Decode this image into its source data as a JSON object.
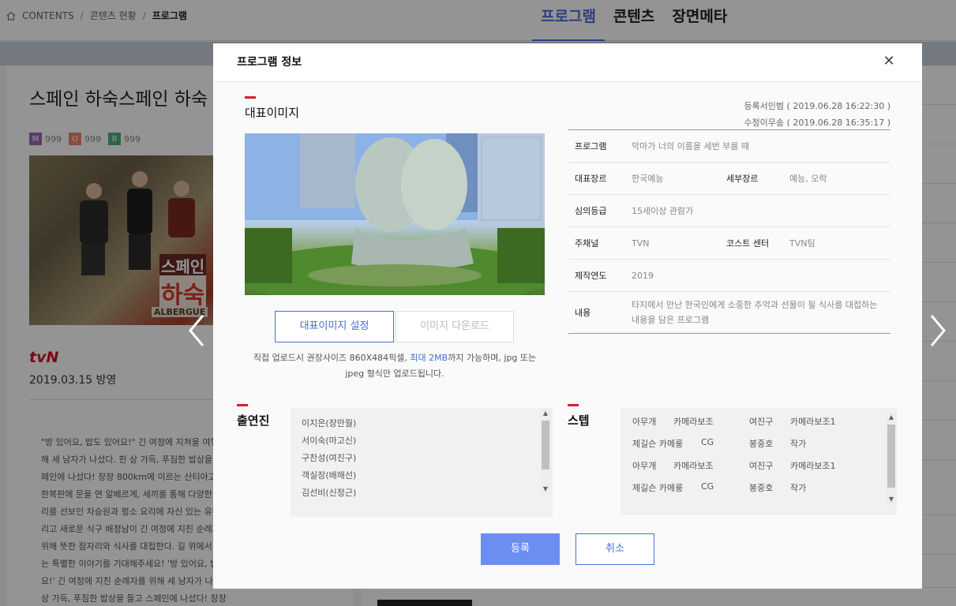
{
  "breadcrumb": {
    "items": [
      "CONTENTS",
      "콘텐츠 현황",
      "프로그램"
    ],
    "separator": "/"
  },
  "tabs": [
    {
      "label": "프로그램",
      "active": true
    },
    {
      "label": "콘텐츠",
      "active": false
    },
    {
      "label": "장면메타",
      "active": false
    }
  ],
  "left_panel": {
    "title": "스페인 하숙스페인 하숙",
    "badges": [
      {
        "letter": "M",
        "count": "999",
        "color": "#9b6bb5"
      },
      {
        "letter": "O",
        "count": "999",
        "color": "#e8876b"
      },
      {
        "letter": "B",
        "count": "999",
        "color": "#4caf7a"
      }
    ],
    "poster_text_1": "스페인",
    "poster_text_2": "하숙",
    "poster_text_3": "ALBERGUE",
    "channel_logo": "tvN",
    "air_date": "2019.03.15 방영",
    "description": "\"방 있어요, 밥도 있어요!\" 긴 여정에 지쳐을 여행자를 위해 세 남자가 나섰다. 한 상 가득, 푸짐한 밥상을 들고 스페인에 나섰다! 장장 800km에 이르는 산티아고 순례길 한복판에 문을 연 알베르게, 세끼를 통해 다양한 한식요리를 선보인 차승원과 펑소 요리에 자신 있는 유해진, 그리고 새로운 식구 배정남이 긴 여정에 지친 순례자들을 위해 뜻한 잠자리와 식사를 대접한다. 길 위에서 펼쳐지는 특별한 이야기를 기대해주세요! '방 있어요, 밥도 있어요!' 긴 여정에 지친 순례자를 위해 세 남자가 나섰다. 한 상 가득, 푸짐한 밥상을 들고 스페인에 나섰다! 장장 800km에 이르는 산티아고 순례길 한복판에 문을 연 알베르게, 세끼를 통해 다양한 한식요리를 선보인 차승원과 펑소 요리에 자신 있는 유해진, 그리고 새로운 식구 배정남이 긴 여정에 지친 한국 여행자도"
  },
  "modal": {
    "title": "프로그램 정보",
    "image_section": {
      "heading": "대표이미지",
      "set_button": "대표이미지 설정",
      "download_button": "이미지 다운로드",
      "note_before": "직접 업로드시 권장사이즈 860X484픽셀, ",
      "note_highlight": "최대 2MB",
      "note_after": "까지 가능하며, jpg 또는 jpeg 형식만 업로드됩니다."
    },
    "meta": {
      "registered": "등록서인범 ( 2019.06.28 16:22:30 )",
      "modified": "수정이무송 ( 2019.06.28 16:35:17 )"
    },
    "info_rows": [
      {
        "label": "프로그램",
        "value": "악마가 너의 이름을 세번 부를 때"
      },
      {
        "label": "대표장르",
        "value": "한국예능",
        "label2": "세부장르",
        "value2": "예능, 오락"
      },
      {
        "label": "심의등급",
        "value": "15세이상 관람가"
      },
      {
        "label": "주채널",
        "value": "TVN",
        "label2": "코스트 센터",
        "value2": "TVN팀"
      },
      {
        "label": "제작연도",
        "value": "2019"
      },
      {
        "label": "내용",
        "value": "타지에서 만난 한국인에게 소중한 추억과 선물이 될 식사를 대접하는 내용을 담은 프로그램"
      }
    ],
    "cast": {
      "heading": "출연진",
      "members": [
        "이지은(장만월)",
        "서이숙(마고신)",
        "구찬성(여진구)",
        "객실장(배해선)",
        "김선비(신정근)"
      ]
    },
    "staff": {
      "heading": "스텝",
      "rows": [
        [
          "아무개",
          "카메라보조",
          "여진구",
          "카메라보조1"
        ],
        [
          "제길슨 카메룽",
          "CG",
          "봉중호",
          "작가"
        ],
        [
          "아무개",
          "카메라보조",
          "여진구",
          "카메라보조1"
        ],
        [
          "제길슨 카메룽",
          "CG",
          "봉중호",
          "작가"
        ]
      ]
    },
    "register_button": "등록",
    "cancel_button": "취소",
    "close_icon": "close-icon"
  },
  "colors": {
    "accent": "#4a6fd8",
    "primary_button": "#6b8ef0",
    "section_marker": "#d32030"
  }
}
